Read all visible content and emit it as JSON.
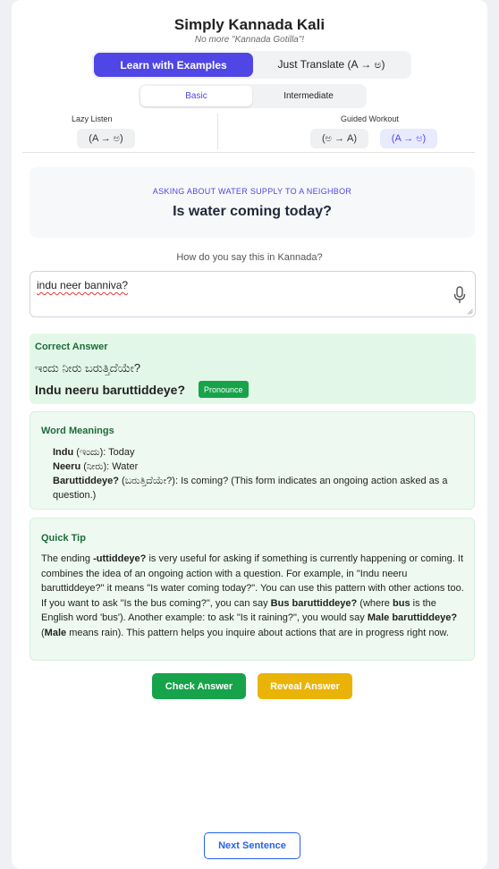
{
  "app": {
    "title": "Simply Kannada Kali",
    "subtitle": "No more \"Kannada Gotilla\"!"
  },
  "mode_tabs": [
    {
      "label": "Learn with Examples",
      "active": true
    },
    {
      "label": "Just Translate (A → ಅ)",
      "active": false
    }
  ],
  "level_tabs": [
    {
      "label": "Basic",
      "active": true
    },
    {
      "label": "Intermediate",
      "active": false
    }
  ],
  "practice": {
    "lazy_listen": {
      "label": "Lazy Listen",
      "button": "(A → ಅ)"
    },
    "guided_workout": {
      "label": "Guided Workout",
      "buttons": [
        "(ಅ → A)",
        "(A → ಅ)"
      ],
      "active_index": 1
    }
  },
  "prompt": {
    "context": "ASKING ABOUT WATER SUPPLY TO A NEIGHBOR",
    "question": "Is water coming today?"
  },
  "input": {
    "label": "How do you say this in Kannada?",
    "value": "indu neer banniva?"
  },
  "correct_answer": {
    "heading": "Correct Answer",
    "kannada": "ಇಂದು ನೀರು ಬರುತ್ತಿದೆಯೇ?",
    "transliteration": "Indu neeru baruttiddeye?",
    "pronounce_label": "Pronounce"
  },
  "word_meanings": {
    "heading": "Word Meanings",
    "items": [
      {
        "word": "Indu",
        "kannada": "(ಇಂದು):",
        "meaning": "Today"
      },
      {
        "word": "Neeru",
        "kannada": "(ನೀರು):",
        "meaning": "Water"
      },
      {
        "word": "Baruttiddeye?",
        "kannada": "(ಬರುತ್ತಿದೆಯೇ?):",
        "meaning": "Is coming? (This form indicates an ongoing action asked as a question.)"
      }
    ]
  },
  "quick_tip": {
    "heading": "Quick Tip",
    "t1": "The ending ",
    "b1": "-uttiddeye?",
    "t2": " is very useful for asking if something is currently happening or coming. It combines the idea of an ongoing action with a question. For example, in \"Indu neeru baruttiddeye?\" it means \"Is water coming today?\". You can use this pattern with other actions too. If you want to ask \"Is the bus coming?\", you can say ",
    "b2": "Bus baruttiddeye?",
    "t3": " (where ",
    "b3": "bus",
    "t4": " is the English word 'bus'). Another example: to ask \"Is it raining?\", you would say ",
    "b4": "Male baruttiddeye?",
    "t5": " (",
    "b5": "Male",
    "t6": " means rain). This pattern helps you inquire about actions that are in progress right now."
  },
  "actions": {
    "check": "Check Answer",
    "reveal": "Reveal Answer",
    "next": "Next Sentence"
  },
  "colors": {
    "primary": "#4f46e5",
    "success": "#16a34a",
    "warning": "#eab308",
    "link": "#2563eb"
  }
}
